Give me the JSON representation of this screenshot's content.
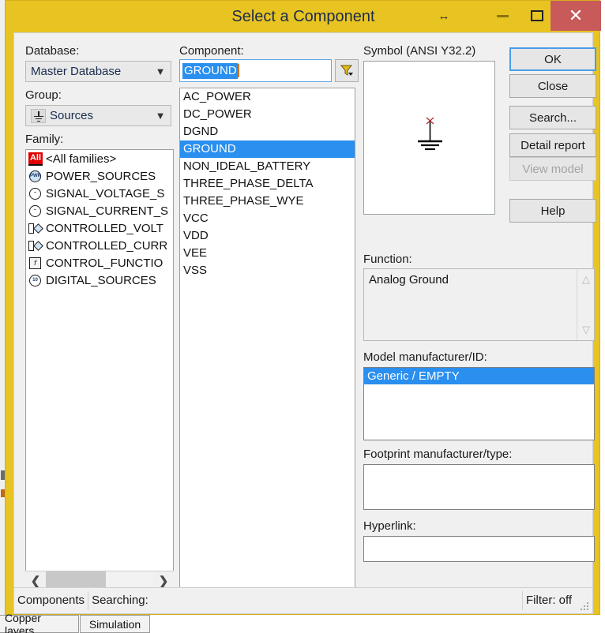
{
  "window": {
    "title": "Select a Component",
    "buttons": {
      "resize_hint": "↔",
      "minimize": "minimize-icon",
      "maximize": "maximize-icon",
      "close": "✕"
    },
    "colors": {
      "titlebar": "#e8c423",
      "close_button": "#c85a5a",
      "selection": "#2a8fef",
      "client": "#f0f0f0"
    }
  },
  "left": {
    "database_label": "Database:",
    "database_value": "Master Database",
    "group_label": "Group:",
    "group_value": "Sources",
    "group_icon": "ground-symbol-icon",
    "family_label": "Family:",
    "family_items": [
      {
        "label": "<All families>",
        "icon": "all-families-icon",
        "state": "normal"
      },
      {
        "label": "POWER_SOURCES",
        "icon": "power-sources-icon",
        "state": "softselected"
      },
      {
        "label": "SIGNAL_VOLTAGE_S",
        "icon": "signal-voltage-source-icon",
        "state": "normal"
      },
      {
        "label": "SIGNAL_CURRENT_S",
        "icon": "signal-current-source-icon",
        "state": "normal"
      },
      {
        "label": "CONTROLLED_VOLT",
        "icon": "controlled-voltage-source-icon",
        "state": "normal"
      },
      {
        "label": "CONTROLLED_CURR",
        "icon": "controlled-current-source-icon",
        "state": "normal"
      },
      {
        "label": "CONTROL_FUNCTIO",
        "icon": "control-function-icon",
        "state": "normal"
      },
      {
        "label": "DIGITAL_SOURCES",
        "icon": "digital-sources-icon",
        "state": "normal"
      }
    ],
    "scroll_left": "❮",
    "scroll_right": "❯"
  },
  "component": {
    "label": "Component:",
    "search_value": "GROUND",
    "filter_button_icon": "filter-funnel-icon",
    "items": [
      "AC_POWER",
      "DC_POWER",
      "DGND",
      "GROUND",
      "NON_IDEAL_BATTERY",
      "THREE_PHASE_DELTA",
      "THREE_PHASE_WYE",
      "VCC",
      "VDD",
      "VEE",
      "VSS"
    ],
    "selected": "GROUND"
  },
  "symbol": {
    "label": "Symbol (ANSI Y32.2)",
    "glyph": "ground-symbol"
  },
  "actions": {
    "ok": "OK",
    "close": "Close",
    "search": "Search...",
    "detail_report": "Detail report",
    "view_model": "View model",
    "help": "Help"
  },
  "details": {
    "function_label": "Function:",
    "function_value": "Analog Ground",
    "model_label": "Model manufacturer/ID:",
    "model_value": "Generic / EMPTY",
    "footprint_label": "Footprint manufacturer/type:",
    "footprint_value": "",
    "hyperlink_label": "Hyperlink:",
    "hyperlink_value": ""
  },
  "statusbar": {
    "components": "Components",
    "searching": "Searching:",
    "filter": "Filter: off"
  },
  "tabs": [
    {
      "label": "Copper layers"
    },
    {
      "label": "Simulation"
    }
  ]
}
